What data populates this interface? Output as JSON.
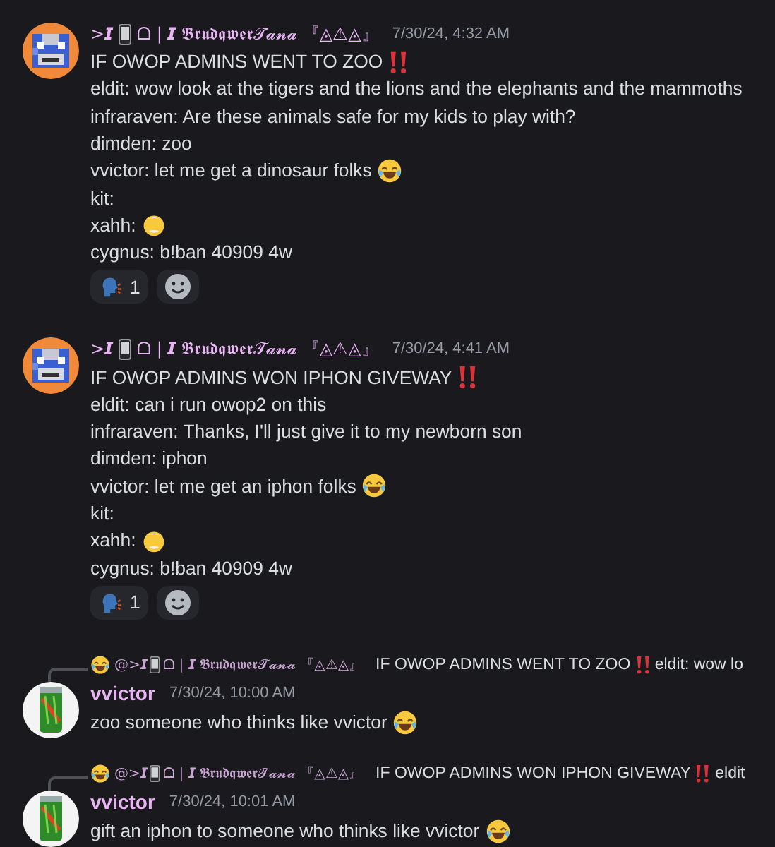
{
  "messages": [
    {
      "kind": "post",
      "author_before": ">𝙄",
      "author_after": "ᗝ | 𝙄 𝕭𝖗𝖚𝖉𝖖𝖜𝖊𝖗𝓣𝓪𝓷𝓪 『◬⚠◬』",
      "timestamp": "7/30/24, 4:32 AM",
      "lines": [
        {
          "kind": "alert",
          "text": "IF OWOP ADMINS WENT TO ZOO"
        },
        {
          "kind": "plain",
          "text": "eldit: wow look at the tigers and the lions and the elephants and the mammoths"
        },
        {
          "kind": "plain",
          "text": "infraraven: Are these animals safe for my kids to play with?"
        },
        {
          "kind": "plain",
          "text": "dimden: zoo"
        },
        {
          "kind": "laugh",
          "text": "vvictor: let me get a dinosaur folks"
        },
        {
          "kind": "plain",
          "text": "kit:"
        },
        {
          "kind": "elder",
          "text": "xahh:"
        },
        {
          "kind": "plain",
          "text": "cygnus: b!ban 40909 4w"
        }
      ],
      "reactions": [
        {
          "kind": "speaking-head",
          "count": "1"
        }
      ]
    },
    {
      "kind": "post",
      "author_before": ">𝙄",
      "author_after": "ᗝ | 𝙄 𝕭𝖗𝖚𝖉𝖖𝖜𝖊𝖗𝓣𝓪𝓷𝓪 『◬⚠◬』",
      "timestamp": "7/30/24, 4:41 AM",
      "lines": [
        {
          "kind": "alert",
          "text": "IF OWOP ADMINS WON IPHON GIVEWAY"
        },
        {
          "kind": "plain",
          "text": "eldit: can i run owop2 on this"
        },
        {
          "kind": "plain",
          "text": "infraraven: Thanks, I'll just give it to my newborn son"
        },
        {
          "kind": "plain",
          "text": "dimden: iphon"
        },
        {
          "kind": "laugh",
          "text": "vvictor: let me get an iphon folks"
        },
        {
          "kind": "plain",
          "text": "kit:"
        },
        {
          "kind": "elder",
          "text": "xahh:"
        },
        {
          "kind": "plain",
          "text": "cygnus: b!ban 40909 4w"
        }
      ],
      "reactions": [
        {
          "kind": "speaking-head",
          "count": "1"
        }
      ]
    },
    {
      "kind": "reply",
      "reply": {
        "author_before": "@>𝙄",
        "author_after": "ᗝ | 𝙄 𝕭𝖗𝖚𝖉𝖖𝖜𝖊𝖗𝓣𝓪𝓷𝓪 『◬⚠◬』",
        "preview": "IF OWOP ADMINS WENT TO ZOO",
        "preview_tail": "eldit: wow lo"
      },
      "author": "vvictor",
      "timestamp": "7/30/24, 10:00 AM",
      "body": {
        "kind": "laugh",
        "text": "zoo someone who thinks like vvictor"
      }
    },
    {
      "kind": "reply",
      "reply": {
        "author_before": "@>𝙄",
        "author_after": "ᗝ | 𝙄 𝕭𝖗𝖚𝖉𝖖𝖜𝖊𝖗𝓣𝓪𝓷𝓪 『◬⚠◬』",
        "preview": "IF OWOP ADMINS WON IPHON GIVEWAY",
        "preview_tail": "eldit"
      },
      "author": "vvictor",
      "timestamp": "7/30/24, 10:01 AM",
      "body": {
        "kind": "laugh",
        "text": "gift an iphon to someone who thinks like vvictor"
      }
    }
  ]
}
